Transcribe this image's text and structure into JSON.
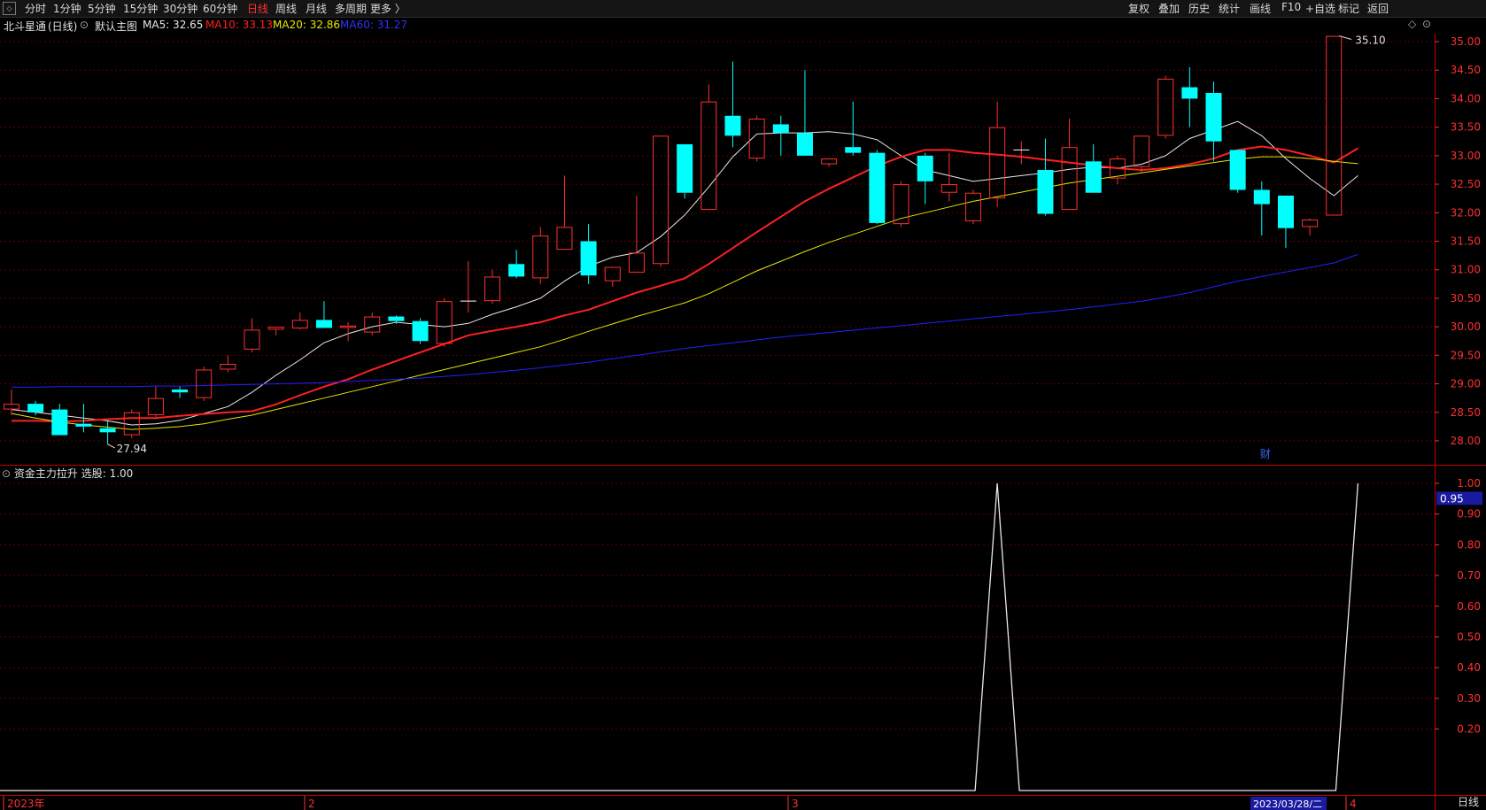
{
  "toolbar": {
    "periods": [
      "分时",
      "1分钟",
      "5分钟",
      "15分钟",
      "30分钟",
      "60分钟",
      "日线",
      "周线",
      "月线",
      "多周期",
      "更多 〉"
    ],
    "active_period": "日线",
    "actions": [
      "复权",
      "叠加",
      "历史",
      "统计",
      "画线",
      "F10",
      "+自选",
      "标记",
      "返回"
    ]
  },
  "infobar": {
    "stock_name": "北斗星通",
    "period_tag": "(日线)",
    "template": "默认主图",
    "ma5": "MA5: 32.65",
    "ma10": "MA10: 33.13",
    "ma20": "MA20: 32.86",
    "ma60": "MA60: 31.27"
  },
  "indicator": {
    "name": "资金主力拉升",
    "value_label": "选股: 1.00",
    "current_value_tag": "0.95"
  },
  "annotations": {
    "high_label": "35.10",
    "low_label": "27.94",
    "finance_marker": "财"
  },
  "time_axis": {
    "labels": [
      "2023年",
      "2",
      "3",
      "4"
    ],
    "current_date": "2023/03/28/二",
    "period_corner": "日线"
  },
  "colors": {
    "up": "#ff3030",
    "down": "#00ffff",
    "ma5": "#e8e8e8",
    "ma10": "#ff2020",
    "ma20": "#e6e600",
    "ma60": "#2020ff",
    "grid": "#5a0000",
    "axis_text": "#ff3030",
    "panel_border": "#c00000"
  },
  "chart_data": [
    {
      "type": "candlestick",
      "title": "北斗星通 (日线)",
      "ylim": [
        27.5,
        35.25
      ],
      "y_ticks": [
        28.0,
        28.5,
        29.0,
        29.5,
        30.0,
        30.5,
        31.0,
        31.5,
        32.0,
        32.5,
        33.0,
        33.5,
        34.0,
        34.5,
        35.0
      ],
      "candles": [
        {
          "o": 28.55,
          "h": 28.9,
          "l": 28.45,
          "c": 28.65
        },
        {
          "o": 28.65,
          "h": 28.7,
          "l": 28.45,
          "c": 28.5
        },
        {
          "o": 28.55,
          "h": 28.65,
          "l": 28.1,
          "c": 28.1
        },
        {
          "o": 28.3,
          "h": 28.65,
          "l": 28.15,
          "c": 28.25
        },
        {
          "o": 28.22,
          "h": 28.35,
          "l": 27.94,
          "c": 28.15
        },
        {
          "o": 28.1,
          "h": 28.55,
          "l": 28.05,
          "c": 28.5
        },
        {
          "o": 28.45,
          "h": 28.95,
          "l": 28.4,
          "c": 28.75
        },
        {
          "o": 28.9,
          "h": 28.95,
          "l": 28.75,
          "c": 28.85
        },
        {
          "o": 28.75,
          "h": 29.3,
          "l": 28.7,
          "c": 29.25
        },
        {
          "o": 29.25,
          "h": 29.5,
          "l": 29.2,
          "c": 29.35
        },
        {
          "o": 29.6,
          "h": 30.15,
          "l": 29.55,
          "c": 29.95
        },
        {
          "o": 29.95,
          "h": 29.99,
          "l": 29.85,
          "c": 30.0
        },
        {
          "o": 29.97,
          "h": 30.25,
          "l": 29.95,
          "c": 30.12
        },
        {
          "o": 30.12,
          "h": 30.45,
          "l": 29.98,
          "c": 29.98
        },
        {
          "o": 29.98,
          "h": 30.08,
          "l": 29.75,
          "c": 30.02
        },
        {
          "o": 29.9,
          "h": 30.25,
          "l": 29.85,
          "c": 30.18
        },
        {
          "o": 30.18,
          "h": 30.2,
          "l": 30.05,
          "c": 30.1
        },
        {
          "o": 30.1,
          "h": 30.15,
          "l": 29.7,
          "c": 29.75
        },
        {
          "o": 29.7,
          "h": 30.5,
          "l": 29.65,
          "c": 30.45
        },
        {
          "o": 30.45,
          "h": 31.15,
          "l": 30.25,
          "c": 30.45
        },
        {
          "o": 30.45,
          "h": 31.0,
          "l": 30.4,
          "c": 30.88
        },
        {
          "o": 31.1,
          "h": 31.35,
          "l": 30.85,
          "c": 30.88
        },
        {
          "o": 30.85,
          "h": 31.75,
          "l": 30.75,
          "c": 31.6
        },
        {
          "o": 31.35,
          "h": 32.65,
          "l": 31.35,
          "c": 31.75
        },
        {
          "o": 31.5,
          "h": 31.8,
          "l": 30.75,
          "c": 30.9
        },
        {
          "o": 30.8,
          "h": 31.05,
          "l": 30.7,
          "c": 31.05
        },
        {
          "o": 30.95,
          "h": 32.3,
          "l": 30.95,
          "c": 31.3
        },
        {
          "o": 31.1,
          "h": 33.35,
          "l": 31.05,
          "c": 33.35
        },
        {
          "o": 33.2,
          "h": 33.2,
          "l": 32.25,
          "c": 32.35
        },
        {
          "o": 32.05,
          "h": 34.25,
          "l": 32.05,
          "c": 33.95
        },
        {
          "o": 33.7,
          "h": 34.65,
          "l": 33.15,
          "c": 33.35
        },
        {
          "o": 32.95,
          "h": 33.7,
          "l": 32.9,
          "c": 33.65
        },
        {
          "o": 33.55,
          "h": 33.7,
          "l": 33.0,
          "c": 33.4
        },
        {
          "o": 33.4,
          "h": 34.5,
          "l": 33.0,
          "c": 33.0
        },
        {
          "o": 32.85,
          "h": 32.95,
          "l": 32.8,
          "c": 32.95
        },
        {
          "o": 33.15,
          "h": 33.95,
          "l": 33.0,
          "c": 33.05
        },
        {
          "o": 33.05,
          "h": 33.1,
          "l": 31.8,
          "c": 31.82
        },
        {
          "o": 31.8,
          "h": 32.55,
          "l": 31.75,
          "c": 32.5
        },
        {
          "o": 33.0,
          "h": 33.05,
          "l": 32.15,
          "c": 32.55
        },
        {
          "o": 32.35,
          "h": 33.05,
          "l": 32.2,
          "c": 32.5
        },
        {
          "o": 31.85,
          "h": 32.4,
          "l": 31.8,
          "c": 32.35
        },
        {
          "o": 32.25,
          "h": 33.95,
          "l": 32.1,
          "c": 33.5
        },
        {
          "o": 33.1,
          "h": 33.25,
          "l": 32.85,
          "c": 33.1
        },
        {
          "o": 32.75,
          "h": 33.3,
          "l": 31.95,
          "c": 31.98
        },
        {
          "o": 32.05,
          "h": 33.65,
          "l": 32.05,
          "c": 33.15
        },
        {
          "o": 32.9,
          "h": 33.2,
          "l": 32.35,
          "c": 32.35
        },
        {
          "o": 32.6,
          "h": 33.0,
          "l": 32.5,
          "c": 32.95
        },
        {
          "o": 32.8,
          "h": 33.35,
          "l": 32.7,
          "c": 33.35
        },
        {
          "o": 33.35,
          "h": 34.4,
          "l": 33.3,
          "c": 34.35
        },
        {
          "o": 34.2,
          "h": 34.55,
          "l": 33.5,
          "c": 34.0
        },
        {
          "o": 34.1,
          "h": 34.3,
          "l": 32.9,
          "c": 33.25
        },
        {
          "o": 33.1,
          "h": 33.1,
          "l": 32.35,
          "c": 32.4
        },
        {
          "o": 32.4,
          "h": 32.55,
          "l": 31.6,
          "c": 32.15
        },
        {
          "o": 32.3,
          "h": 32.3,
          "l": 31.38,
          "c": 31.73
        },
        {
          "o": 31.75,
          "h": 31.9,
          "l": 31.6,
          "c": 31.88
        },
        {
          "o": 31.95,
          "h": 35.1,
          "l": 31.95,
          "c": 35.1
        }
      ],
      "ma": {
        "ma5": [
          28.55,
          28.5,
          28.45,
          28.4,
          28.35,
          28.28,
          28.3,
          28.36,
          28.48,
          28.6,
          28.85,
          29.15,
          29.42,
          29.72,
          29.88,
          30.0,
          30.08,
          30.04,
          30.0,
          30.06,
          30.22,
          30.35,
          30.5,
          30.8,
          31.06,
          31.22,
          31.3,
          31.58,
          31.96,
          32.45,
          32.98,
          33.38,
          33.4,
          33.4,
          33.42,
          33.38,
          33.28,
          33.0,
          32.75,
          32.65,
          32.55,
          32.6,
          32.65,
          32.7,
          32.76,
          32.8,
          32.78,
          32.85,
          33.0,
          33.3,
          33.45,
          33.6,
          33.35,
          32.95,
          32.6,
          32.3,
          32.65
        ],
        "ma10": [
          28.35,
          28.35,
          28.34,
          28.35,
          28.38,
          28.4,
          28.4,
          28.44,
          28.47,
          28.5,
          28.52,
          28.64,
          28.8,
          28.95,
          29.08,
          29.25,
          29.4,
          29.55,
          29.7,
          29.85,
          29.93,
          30.0,
          30.08,
          30.2,
          30.3,
          30.45,
          30.6,
          30.72,
          30.85,
          31.1,
          31.38,
          31.66,
          31.93,
          32.2,
          32.42,
          32.62,
          32.82,
          32.98,
          33.1,
          33.1,
          33.05,
          33.02,
          32.98,
          32.93,
          32.88,
          32.83,
          32.78,
          32.75,
          32.78,
          32.85,
          32.95,
          33.1,
          33.16,
          33.1,
          33.0,
          32.88,
          33.13
        ],
        "ma20": [
          28.48,
          28.4,
          28.33,
          28.28,
          28.24,
          28.2,
          28.22,
          28.25,
          28.3,
          28.38,
          28.45,
          28.55,
          28.65,
          28.75,
          28.85,
          28.95,
          29.05,
          29.15,
          29.25,
          29.35,
          29.45,
          29.55,
          29.65,
          29.78,
          29.92,
          30.05,
          30.18,
          30.3,
          30.42,
          30.58,
          30.78,
          30.98,
          31.15,
          31.32,
          31.48,
          31.62,
          31.76,
          31.9,
          32.0,
          32.1,
          32.2,
          32.28,
          32.36,
          32.44,
          32.52,
          32.58,
          32.64,
          32.7,
          32.76,
          32.82,
          32.88,
          32.94,
          32.98,
          32.98,
          32.95,
          32.9,
          32.86
        ],
        "ma60": [
          28.94,
          28.94,
          28.95,
          28.95,
          28.95,
          28.95,
          28.96,
          28.96,
          28.97,
          28.98,
          28.99,
          29.0,
          29.01,
          29.02,
          29.04,
          29.06,
          29.08,
          29.1,
          29.13,
          29.16,
          29.2,
          29.24,
          29.28,
          29.33,
          29.38,
          29.44,
          29.5,
          29.56,
          29.62,
          29.67,
          29.72,
          29.77,
          29.82,
          29.86,
          29.9,
          29.94,
          29.98,
          30.02,
          30.06,
          30.1,
          30.14,
          30.18,
          30.22,
          30.26,
          30.3,
          30.35,
          30.4,
          30.45,
          30.52,
          30.6,
          30.7,
          30.8,
          30.88,
          30.96,
          31.04,
          31.12,
          31.27
        ]
      }
    },
    {
      "type": "line",
      "title": "资金主力拉升",
      "ylim": [
        0,
        1.0
      ],
      "y_ticks": [
        0.2,
        0.3,
        0.4,
        0.5,
        0.6,
        0.7,
        0.8,
        0.9,
        1.0
      ],
      "series": [
        {
          "name": "选股",
          "values": [
            0,
            0,
            0,
            0,
            0,
            0,
            0,
            0,
            0,
            0,
            0,
            0,
            0,
            0,
            0,
            0,
            0,
            0,
            0,
            0,
            0,
            0,
            0,
            0,
            0,
            0,
            0,
            0,
            0,
            0,
            0,
            0,
            0,
            0,
            0,
            0,
            0,
            0,
            0,
            0,
            0,
            1,
            0,
            0,
            0,
            0,
            0,
            0,
            0,
            0,
            0,
            0,
            0,
            0,
            0,
            0,
            1
          ]
        }
      ]
    }
  ]
}
